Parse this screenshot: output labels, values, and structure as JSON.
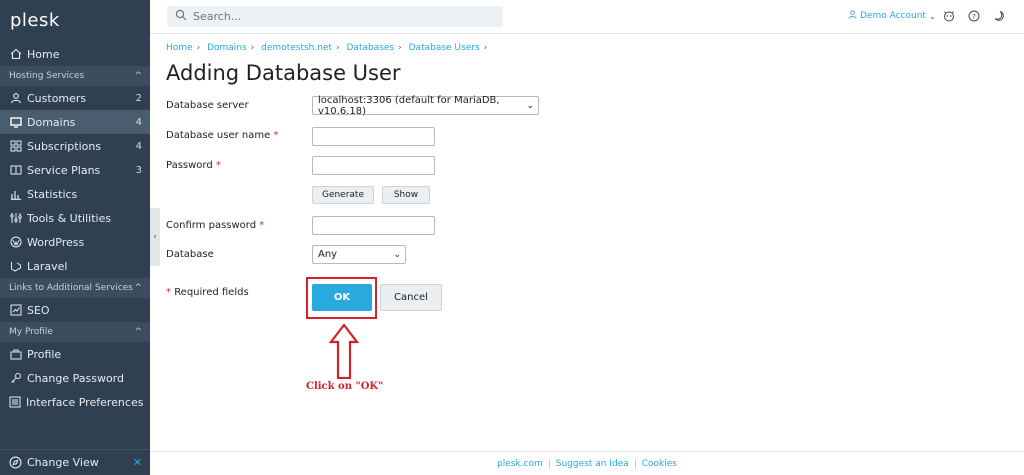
{
  "app": {
    "logo": "plesk"
  },
  "sidebar": {
    "home": "Home",
    "sections": {
      "hosting": "Hosting Services",
      "links": "Links to Additional Services",
      "profile": "My Profile"
    },
    "hosting_items": [
      {
        "label": "Customers",
        "count": "2"
      },
      {
        "label": "Domains",
        "count": "4"
      },
      {
        "label": "Subscriptions",
        "count": "4"
      },
      {
        "label": "Service Plans",
        "count": "3"
      },
      {
        "label": "Statistics",
        "count": ""
      },
      {
        "label": "Tools & Utilities",
        "count": ""
      },
      {
        "label": "WordPress",
        "count": ""
      },
      {
        "label": "Laravel",
        "count": ""
      }
    ],
    "links_items": [
      {
        "label": "SEO"
      }
    ],
    "profile_items": [
      {
        "label": "Profile"
      },
      {
        "label": "Change Password"
      },
      {
        "label": "Interface Preferences"
      }
    ],
    "change_view": "Change View"
  },
  "topbar": {
    "search_placeholder": "Search...",
    "account": "Demo Account"
  },
  "breadcrumb": [
    "Home",
    "Domains",
    "demotestsh.net",
    "Databases",
    "Database Users"
  ],
  "page_title": "Adding Database User",
  "form": {
    "server_label": "Database server",
    "server_value": "localhost:3306 (default for MariaDB, v10.6.18)",
    "username_label": "Database user name",
    "password_label": "Password",
    "generate_label": "Generate",
    "show_label": "Show",
    "confirm_label": "Confirm password",
    "database_label": "Database",
    "database_value": "Any",
    "required_note": "Required fields",
    "required_mark": "*",
    "ok_label": "OK",
    "cancel_label": "Cancel"
  },
  "annotation": {
    "text": "Click on \"OK\"",
    "color": "#d2232a"
  },
  "footer": [
    "plesk.com",
    "Suggest an Idea",
    "Cookies"
  ],
  "colors": {
    "accent": "#28aade",
    "sidebar": "#2f4050",
    "required": "#d02d2d"
  }
}
